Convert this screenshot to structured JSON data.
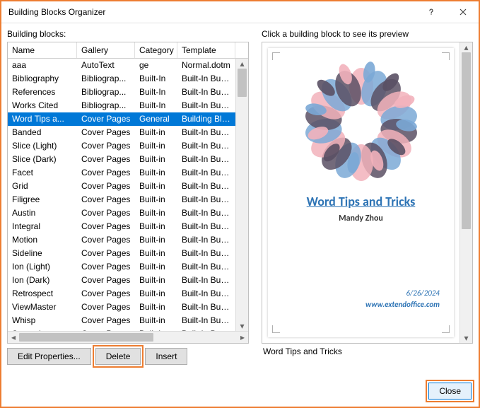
{
  "title": "Building Blocks Organizer",
  "left_label": "Building blocks:",
  "right_label": "Click a building block to see its preview",
  "columns": {
    "name": "Name",
    "gallery": "Gallery",
    "category": "Category",
    "template": "Template"
  },
  "rows": [
    {
      "name": "aaa",
      "gallery": "AutoText",
      "category": "ge",
      "template": "Normal.dotm",
      "selected": false
    },
    {
      "name": "Bibliography",
      "gallery": "Bibliograp...",
      "category": "Built-In",
      "template": "Built-In Buil...",
      "selected": false
    },
    {
      "name": "References",
      "gallery": "Bibliograp...",
      "category": "Built-In",
      "template": "Built-In Buil...",
      "selected": false
    },
    {
      "name": "Works Cited",
      "gallery": "Bibliograp...",
      "category": "Built-In",
      "template": "Built-In Buil...",
      "selected": false
    },
    {
      "name": "Word Tips a...",
      "gallery": "Cover Pages",
      "category": "General",
      "template": "Building Blo...",
      "selected": true
    },
    {
      "name": "Banded",
      "gallery": "Cover Pages",
      "category": "Built-in",
      "template": "Built-In Buil...",
      "selected": false
    },
    {
      "name": "Slice (Light)",
      "gallery": "Cover Pages",
      "category": "Built-in",
      "template": "Built-In Buil...",
      "selected": false
    },
    {
      "name": "Slice (Dark)",
      "gallery": "Cover Pages",
      "category": "Built-in",
      "template": "Built-In Buil...",
      "selected": false
    },
    {
      "name": "Facet",
      "gallery": "Cover Pages",
      "category": "Built-in",
      "template": "Built-In Buil...",
      "selected": false
    },
    {
      "name": "Grid",
      "gallery": "Cover Pages",
      "category": "Built-in",
      "template": "Built-In Buil...",
      "selected": false
    },
    {
      "name": "Filigree",
      "gallery": "Cover Pages",
      "category": "Built-in",
      "template": "Built-In Buil...",
      "selected": false
    },
    {
      "name": "Austin",
      "gallery": "Cover Pages",
      "category": "Built-in",
      "template": "Built-In Buil...",
      "selected": false
    },
    {
      "name": "Integral",
      "gallery": "Cover Pages",
      "category": "Built-in",
      "template": "Built-In Buil...",
      "selected": false
    },
    {
      "name": "Motion",
      "gallery": "Cover Pages",
      "category": "Built-in",
      "template": "Built-In Buil...",
      "selected": false
    },
    {
      "name": "Sideline",
      "gallery": "Cover Pages",
      "category": "Built-in",
      "template": "Built-In Buil...",
      "selected": false
    },
    {
      "name": "Ion (Light)",
      "gallery": "Cover Pages",
      "category": "Built-in",
      "template": "Built-In Buil...",
      "selected": false
    },
    {
      "name": "Ion (Dark)",
      "gallery": "Cover Pages",
      "category": "Built-in",
      "template": "Built-In Buil...",
      "selected": false
    },
    {
      "name": "Retrospect",
      "gallery": "Cover Pages",
      "category": "Built-in",
      "template": "Built-In Buil...",
      "selected": false
    },
    {
      "name": "ViewMaster",
      "gallery": "Cover Pages",
      "category": "Built-in",
      "template": "Built-In Buil...",
      "selected": false
    },
    {
      "name": "Whisp",
      "gallery": "Cover Pages",
      "category": "Built-in",
      "template": "Built-In Buil...",
      "selected": false
    },
    {
      "name": "Semaphore",
      "gallery": "Cover Pages",
      "category": "Built-in",
      "template": "Built-In Buil...",
      "selected": false
    }
  ],
  "buttons": {
    "edit_properties": "Edit Properties...",
    "delete": "Delete",
    "insert": "Insert",
    "close": "Close"
  },
  "preview": {
    "doc_title": "Word Tips and Tricks",
    "doc_subtitle": "Mandy Zhou",
    "doc_date": "6/26/2024",
    "doc_url": "www.extendoffice.com",
    "name": "Word Tips and Tricks"
  },
  "wreath_colors": {
    "pink": "#f2b1bb",
    "blue": "#7ba9d6",
    "dark": "#5a5064"
  }
}
